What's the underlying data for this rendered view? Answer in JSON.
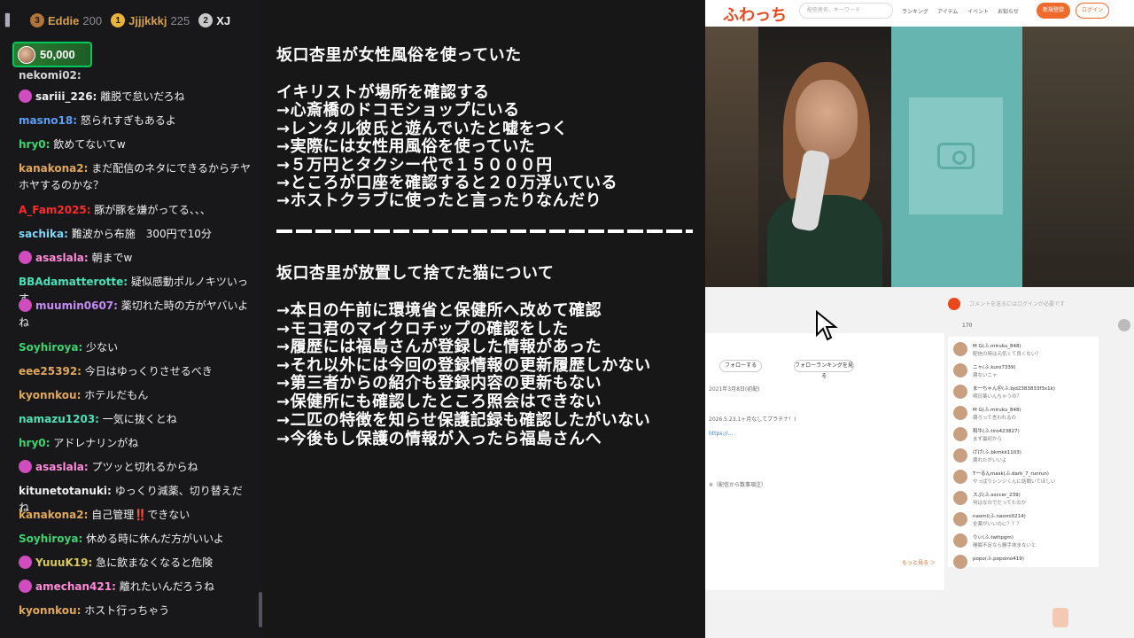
{
  "leaderboard": {
    "menu_icon": "menu-icon",
    "entries": [
      {
        "rank": "3",
        "name": "Eddie",
        "score": "200",
        "rank_color": "#b0743a"
      },
      {
        "rank": "1",
        "name": "Jjjjkkkj",
        "score": "225",
        "rank_color": "#e8b43a"
      },
      {
        "rank": "2",
        "name": "XJ",
        "score": "",
        "rank_color": "#c8c8c8"
      }
    ]
  },
  "pill": {
    "value": "50,000"
  },
  "chat": {
    "messages": [
      {
        "user": "nekomi02:",
        "text": "",
        "color": "#d3d3d3",
        "badge": false
      },
      {
        "user": "sariii_226:",
        "text": "離脱で怠いだろね",
        "color": "#efeff1",
        "badge": true
      },
      {
        "user": "masno18:",
        "text": "怒られすぎもあるよ",
        "color": "#5a9ef5",
        "badge": false
      },
      {
        "user": "hry0:",
        "text": "飲めてないてw",
        "color": "#3cd46e",
        "badge": false
      },
      {
        "user": "kanakona2:",
        "text": "まだ配信のネタにできるからチヤホヤするのかな？",
        "color": "#e0a85a",
        "badge": false
      },
      {
        "user": "A_Fam2025:",
        "text": "豚が豚を嫌がってる、、、",
        "color": "#ff2a2a",
        "badge": false
      },
      {
        "user": "sachika:",
        "text": "難波から布施　300円で10分",
        "color": "#7fd5f5",
        "badge": false
      },
      {
        "user": "asaslala:",
        "text": "朝までw",
        "color": "#ff8ad8",
        "badge": true
      },
      {
        "user": "BBAdamatterotte:",
        "text": "疑似感動ポルノキツいっす",
        "color": "#4ae0b8",
        "badge": false
      },
      {
        "user": "muumin0607:",
        "text": "薬切れた時の方がヤバいよね",
        "color": "#c58cf5",
        "badge": true
      },
      {
        "user": "Soyhiroya:",
        "text": "少ない",
        "color": "#3cd46e",
        "badge": false
      },
      {
        "user": "eee25392:",
        "text": "今日はゆっくりさせるべき",
        "color": "#e0a85a",
        "badge": false
      },
      {
        "user": "kyonnkou:",
        "text": "ホテルだもん",
        "color": "#e0a85a",
        "badge": false
      },
      {
        "user": "namazu1203:",
        "text": "一気に抜くとね",
        "color": "#4ae0b8",
        "badge": false
      },
      {
        "user": "hry0:",
        "text": "アドレナリンがね",
        "color": "#3cd46e",
        "badge": false
      },
      {
        "user": "asaslala:",
        "text": "プツッと切れるからね",
        "color": "#ff8ad8",
        "badge": true
      },
      {
        "user": "kitunetotanuki:",
        "text": "ゆっくり減薬、切り替えだね",
        "color": "#efeff1",
        "badge": false
      },
      {
        "user": "kanakona2:",
        "text": "自己管理‼️できない",
        "color": "#e0a85a",
        "badge": false
      },
      {
        "user": "Soyhiroya:",
        "text": "休める時に休んだ方がいいよ",
        "color": "#3cd46e",
        "badge": false
      },
      {
        "user": "YuuuK19:",
        "text": "急に飲まなくなると危険",
        "color": "#d8c95a",
        "badge": true
      },
      {
        "user": "amechan421:",
        "text": "離れたいんだろうね",
        "color": "#ff8ad8",
        "badge": true
      },
      {
        "user": "kyonnkou:",
        "text": "ホスト行っちゃう",
        "color": "#e0a85a",
        "badge": false
      }
    ]
  },
  "overlay": {
    "lines": [
      "坂口杏里が女性風俗を使っていた",
      "イキリストが場所を確認する",
      "→心斎橋のドコモショップにいる",
      "→レンタル彼氏と遊んでいたと嘘をつく",
      "→実際には女性用風俗を使っていた",
      "→５万円とタクシー代で１５０００円",
      "→ところが口座を確認すると２０万浮いている",
      "→ホストクラブに使ったと言ったりなんだり",
      "坂口杏里が放置して捨てた猫について",
      "→本日の午前に環境省と保健所へ改めて確認",
      "→モコ君のマイクロチップの確認をした",
      "→履歴には福島さんが登録した情報があった",
      "→それ以外には今回の登録情報の更新履歴しかない",
      "→第三者からの紹介も登録内容の更新もない",
      "→保健所にも確認したところ照会はできない",
      "→二匹の特徴を知らせ保護記録も確認したがいない",
      "→今後もし保護の情報が入ったら福島さんへ"
    ]
  },
  "site": {
    "logo": "ふわっち",
    "search_placeholder": "配信者名、キーワード",
    "nav": [
      "ランキング",
      "アイテム",
      "イベント",
      "お知らせ"
    ],
    "register": "新規登録",
    "login": "ログイン",
    "comment_placeholder": "コメントを送るにはログインが必要です",
    "listeners": "170",
    "follow": "フォローする",
    "follow_ranking": "フォローランキングを見る",
    "more": "もっと見る ＞",
    "profile_texts": [
      "2021年3月8日(初配)",
      "2026.5.23.1ヶ月なしてプラチナ！)",
      "※（配信から数事項注）"
    ],
    "comments": [
      {
        "name": "M G(ふ.miruku_848)",
        "text": "配信の時は元気くて良くない？"
      },
      {
        "name": "ニャ(ふ.kuro7339)",
        "text": "寝ないニャ"
      },
      {
        "name": "ま一ちゃん＠(ふ.bjd2383833f3x1k)",
        "text": "明日薬いんちゃうの？"
      },
      {
        "name": "M G(ふ.miruku_848)",
        "text": "寝ろって言われるの"
      },
      {
        "name": "和牛(ふ.tiro423827)",
        "text": "まず最初から"
      },
      {
        "name": "げげ(ふ.bkmkk1103)",
        "text": "寝れたがいいよ"
      },
      {
        "name": "T一るんmask(ふ.dark_7_runrun)",
        "text": "やっぱりシンジくんに話聞いてほしい"
      },
      {
        "name": "スぷ(ふ.soccer_239)",
        "text": "何はなのでだってたのか"
      },
      {
        "name": "naomi(ふ.naomi0214)",
        "text": "全薬がいいのに？？？"
      },
      {
        "name": "りぃ(ふ.twttpgm)",
        "text": "睡眠不足なら勝手休まないと"
      },
      {
        "name": "popo(ふ.popoino419)",
        "text": ""
      }
    ]
  },
  "colors": {
    "chat_bg": "#18181b",
    "overlay_bg": "#171717",
    "brand": "#ee6a2d",
    "teal": "#67b5b0"
  }
}
